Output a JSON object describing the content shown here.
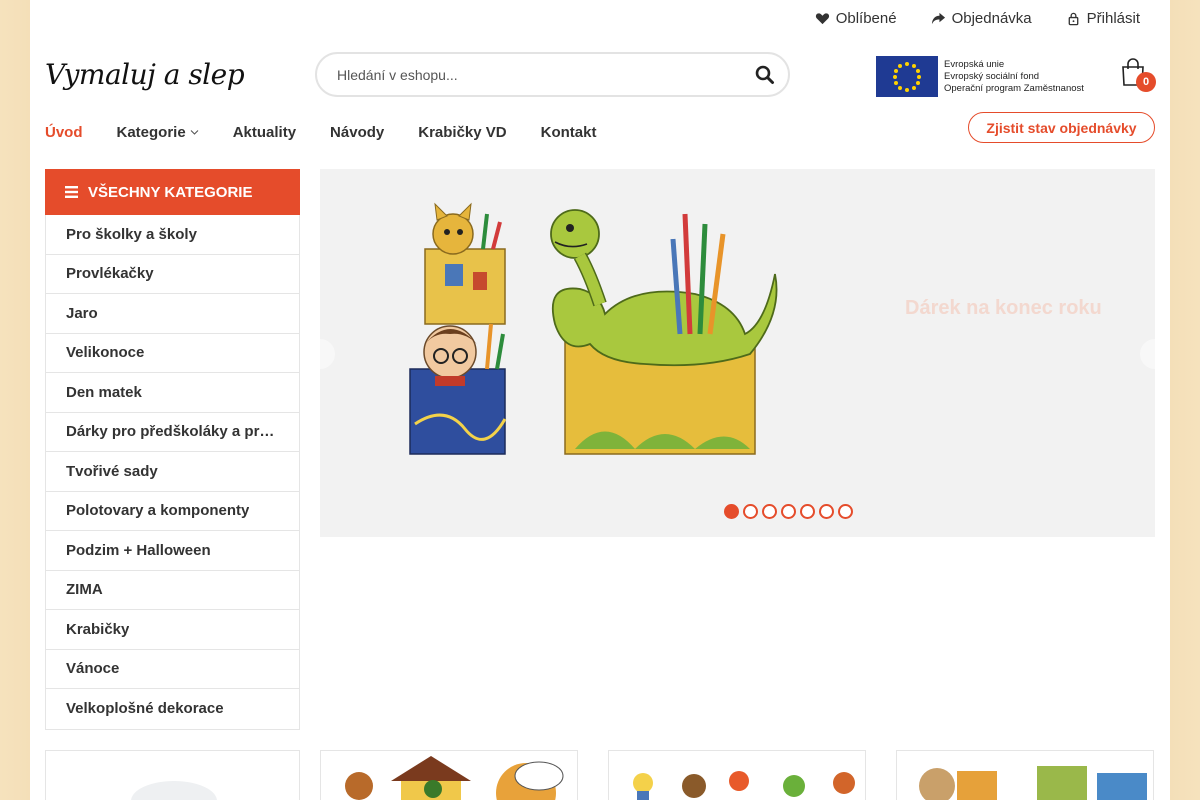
{
  "topbar": {
    "favorites": "Oblíbené",
    "order": "Objednávka",
    "login": "Přihlásit"
  },
  "header": {
    "logo": "Vymaluj a slep",
    "search_placeholder": "Hledání v eshopu...",
    "eu_line1": "Evropská unie",
    "eu_line2": "Evropský sociální fond",
    "eu_line3": "Operační program Zaměstnanost",
    "cart_count": "0"
  },
  "nav": {
    "items": [
      "Úvod",
      "Kategorie",
      "Aktuality",
      "Návody",
      "Krabičky VD",
      "Kontakt"
    ],
    "order_status": "Zjistit stav objednávky"
  },
  "sidebar": {
    "title": "VŠECHNY KATEGORIE",
    "items": [
      "Pro školky a školy",
      "Provlékačky",
      "Jaro",
      "Velikonoce",
      "Den matek",
      "Dárky pro předškoláky a prvňáčky",
      "Tvořivé sady",
      "Polotovary a komponenty",
      "Podzim + Halloween",
      "ZIMA",
      "Krabičky",
      "Vánoce",
      "Velkoplošné dekorace"
    ]
  },
  "slider": {
    "title": "Dárek na konec roku",
    "active_slide": 1,
    "slide_count": 7
  },
  "colors": {
    "accent": "#e54c2b",
    "side_background": "#f4dfb8"
  }
}
